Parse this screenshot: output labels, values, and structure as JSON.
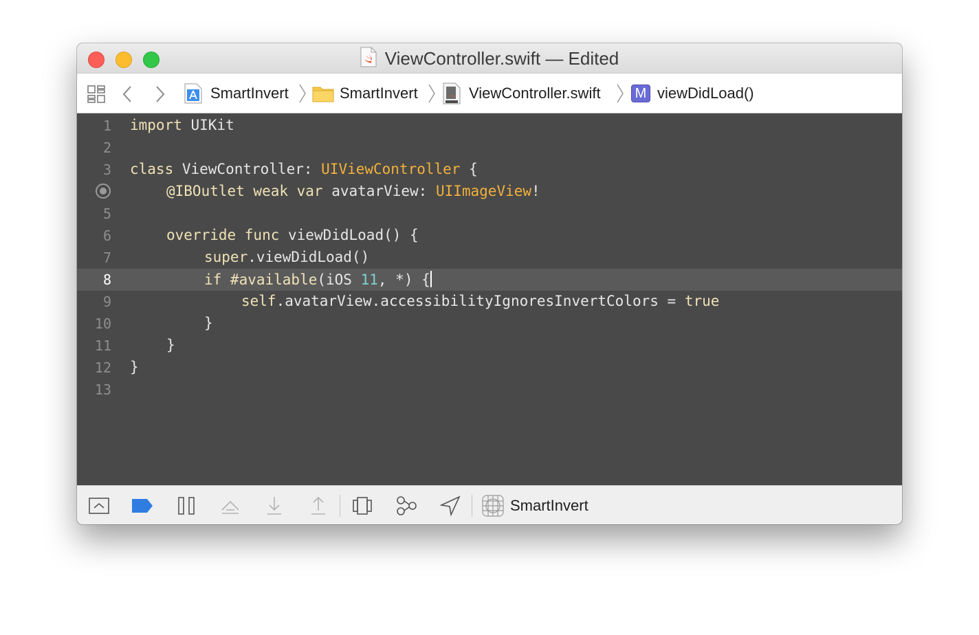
{
  "window": {
    "title": "ViewController.swift — Edited"
  },
  "jumpbar": {
    "crumbs": [
      {
        "label": "SmartInvert",
        "icon": "xcode-project-icon"
      },
      {
        "label": "SmartInvert",
        "icon": "folder-icon"
      },
      {
        "label": "ViewController.swift",
        "icon": "swift-file-icon"
      },
      {
        "label": "viewDidLoad()",
        "icon": "method-icon",
        "badge": "M"
      }
    ]
  },
  "editor": {
    "current_line": 8,
    "lines": [
      {
        "n": "1",
        "text": "import UIKit"
      },
      {
        "n": "2",
        "text": ""
      },
      {
        "n": "3",
        "text": "class ViewController: UIViewController {"
      },
      {
        "n": "4",
        "text": "@IBOutlet weak var avatarView: UIImageView!"
      },
      {
        "n": "5",
        "text": ""
      },
      {
        "n": "6",
        "text": "override func viewDidLoad() {"
      },
      {
        "n": "7",
        "text": "super.viewDidLoad()"
      },
      {
        "n": "8",
        "text": "if #available(iOS 11, *) {"
      },
      {
        "n": "9",
        "text": "self.avatarView.accessibilityIgnoresInvertColors = true"
      },
      {
        "n": "10",
        "text": "}"
      },
      {
        "n": "11",
        "text": "}"
      },
      {
        "n": "12",
        "text": "}"
      },
      {
        "n": "13",
        "text": ""
      }
    ],
    "tokens": {
      "l1_kw": "import",
      "l1_rest": " UIKit",
      "l3_kw": "class",
      "l3_mid": " ViewController: ",
      "l3_ty": "UIViewController",
      "l3_end": " {",
      "l4_kw1": "@IBOutlet weak var",
      "l4_mid": " avatarView: ",
      "l4_ty": "UIImageView",
      "l4_end": "!",
      "l6_kw": "override func",
      "l6_rest": " viewDidLoad() {",
      "l7_kw": "super",
      "l7_rest": ".viewDidLoad()",
      "l8_kw": "if #available",
      "l8_mid": "(iOS ",
      "l8_num": "11",
      "l8_end": ", *) {",
      "l9_kw": "self",
      "l9_mid": ".avatarView.accessibilityIgnoresInvertColors = ",
      "l9_kw2": "true",
      "l10": "}",
      "l11": "}",
      "l12": "}"
    }
  },
  "debugbar": {
    "scheme_label": "SmartInvert",
    "icons": [
      "hide-debug-area-icon",
      "breakpoints-toggle-icon",
      "pause-icon",
      "step-over-icon",
      "step-into-icon",
      "step-out-icon",
      "view-debugger-icon",
      "memory-graph-icon",
      "simulate-location-icon",
      "app-target-icon"
    ]
  },
  "colors": {
    "editor_bg": "#494949",
    "current_line_bg": "#5a5a5a",
    "keyword": "#f0e2b6",
    "type": "#f2b13c",
    "number": "#7fd4d0",
    "breakpoint_blue": "#2f7de1"
  }
}
